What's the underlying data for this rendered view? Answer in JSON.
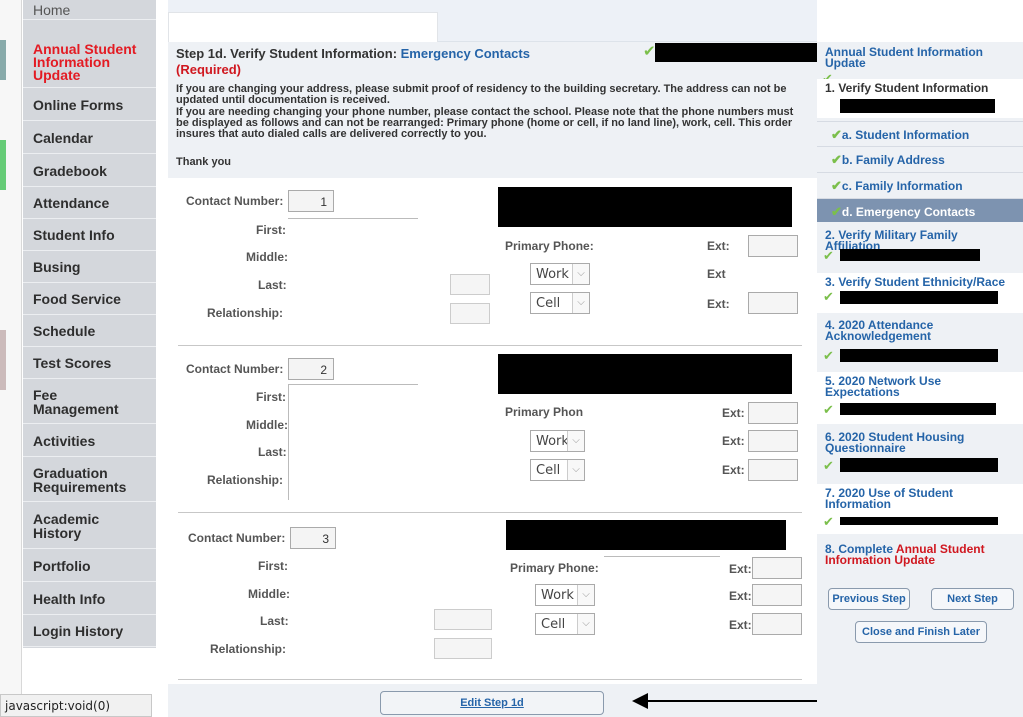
{
  "status_bar": {
    "text": "javascript:void(0)"
  },
  "sidebar": {
    "items": [
      {
        "label": "Home"
      },
      {
        "label": "Annual Student Information Update"
      },
      {
        "label": "Online Forms"
      },
      {
        "label": "Calendar"
      },
      {
        "label": "Gradebook"
      },
      {
        "label": "Attendance"
      },
      {
        "label": "Student Info"
      },
      {
        "label": "Busing"
      },
      {
        "label": "Food Service"
      },
      {
        "label": "Schedule"
      },
      {
        "label": "Test Scores"
      },
      {
        "label": "Fee Management"
      },
      {
        "label": "Activities"
      },
      {
        "label": "Graduation Requirements"
      },
      {
        "label": "Academic History"
      },
      {
        "label": "Portfolio"
      },
      {
        "label": "Health Info"
      },
      {
        "label": "Login History"
      }
    ]
  },
  "header": {
    "title_prefix": "Step 1d. Verify Student Information: ",
    "title_highlight": "Emergency Contacts",
    "required": "(Required)",
    "check_icon": "✔",
    "notice_1": "If you are changing your address, please submit proof of residency to the building secretary. The address can not be updated until documentation is received.",
    "notice_2": "If you are needing changing your phone number, please contact the school. Please note that the phone numbers must be displayed as follows and can not be rearranged: Primary phone (home or cell, if no land line), work, cell. This order insures that auto dialed calls are delivered correctly to you.",
    "thanks": "Thank you"
  },
  "contacts": [
    {
      "label_contact": "Contact Number:",
      "number": "1",
      "label_first": "First:",
      "label_middle": "Middle:",
      "label_last": "Last:",
      "label_relationship": "Relationship:",
      "label_primary": "Primary Phone:",
      "label_ext1": "Ext:",
      "label_ext2": "Ext",
      "label_ext3": "Ext:",
      "work": "Work",
      "cell": "Cell"
    },
    {
      "label_contact": "Contact Number:",
      "number": "2",
      "label_first": "First:",
      "label_middle": "Middle:",
      "label_last": "Last:",
      "label_relationship": "Relationship:",
      "label_primary": "Primary Phon",
      "label_ext1": "Ext:",
      "label_ext2": "Ext:",
      "label_ext3": "Ext:",
      "work": "Work",
      "cell": "Cell"
    },
    {
      "label_contact": "Contact Number:",
      "number": "3",
      "label_first": "First:",
      "label_middle": "Middle:",
      "label_last": "Last:",
      "label_relationship": "Relationship:",
      "label_primary": "Primary Phone:",
      "label_ext1": "Ext:",
      "label_ext2": "Ext:",
      "label_ext3": "Ext:",
      "work": "Work",
      "cell": "Cell"
    }
  ],
  "bottom": {
    "edit_label": "Edit Step 1d"
  },
  "right_panel": {
    "heading": "Annual Student Information Update",
    "step1": "1. Verify Student Information",
    "sub_a": "a. Student Information",
    "sub_b": "b. Family Address",
    "sub_c": "c. Family Information",
    "sub_d": "d. Emergency Contacts",
    "step2": "2. Verify Military Family Affiliation",
    "step3": "3. Verify Student Ethnicity/Race",
    "step4": "4. 2020 Attendance Acknowledgement",
    "step5": "5. 2020 Network Use Expectations",
    "step6": "6. 2020 Student Housing Questionnaire",
    "step7": "7. 2020 Use of Student Information",
    "step8_prefix": "8. Complete ",
    "step8_highlight": "Annual Student Information Update",
    "prev_label": "Previous Step",
    "next_label": "Next Step",
    "close_label": "Close and Finish Later"
  },
  "colors": {
    "accent": "#2564a8",
    "required": "#d0171f",
    "check": "#7bbf4b",
    "active_sub": "#7d93b0",
    "sidebar_bg": "#d4d7dc"
  }
}
